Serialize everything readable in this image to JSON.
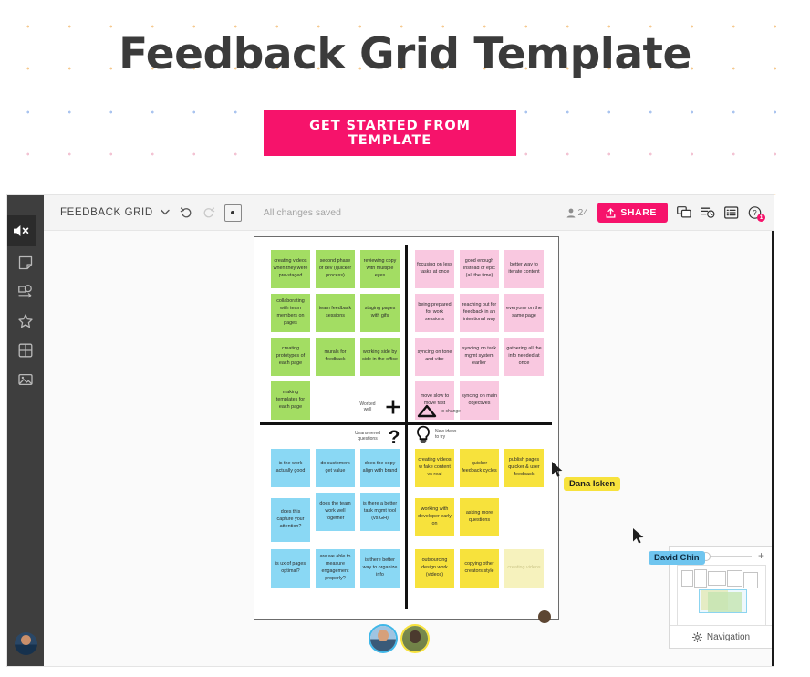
{
  "hero": {
    "title": "Feedback Grid Template",
    "cta_label": "GET STARTED FROM TEMPLATE",
    "accent_color": "#f6136b",
    "title_color": "#3b3b3b"
  },
  "topbar": {
    "board_name": "FEEDBACK GRID",
    "dropdown_icon": "chevron-down-icon",
    "undo_icon": "undo-icon",
    "redo_icon": "redo-icon",
    "pen_icon": "pen-color-icon",
    "save_status": "All changes saved",
    "users_icon": "user-icon",
    "users_count": "24",
    "share_label": "SHARE",
    "share_icon": "upload-icon",
    "comments_icon": "comments-icon",
    "activity_icon": "activity-history-icon",
    "outline_icon": "outline-list-icon",
    "help_icon": "help-question-icon",
    "help_badge": "1"
  },
  "rail": {
    "mute_icon": "speaker-muted-icon",
    "tools": [
      {
        "name": "collapse-panel-icon"
      },
      {
        "name": "sticky-note-icon"
      },
      {
        "name": "shape-connector-icon"
      },
      {
        "name": "star-icon"
      },
      {
        "name": "grid-table-icon"
      },
      {
        "name": "image-icon"
      }
    ],
    "avatar_name": "user-avatar"
  },
  "board": {
    "quadrants": [
      {
        "id": "worked-well",
        "label": "Worked\nwell",
        "icon": "plus-icon",
        "color": "#a3dd63",
        "notes": [
          "creating videos when they were pre-staged",
          "second phase of dev (quicker process)",
          "reviewing copy with multiple eyes",
          "collaborating with team members on pages",
          "team feedback sessions",
          "staging pages with gifs",
          "creating prototypes of each page",
          "murals for feedback",
          "working side by side in the office",
          "making templates for each page"
        ]
      },
      {
        "id": "to-change",
        "label": "to change",
        "icon": "delta-icon",
        "color": "#f9c8e0",
        "notes": [
          "focusing on less tasks at once",
          "good enough instead of epic (all the time)",
          "better way to iterate content",
          "being prepared for work sessions",
          "reaching out for feedback in an intentional way",
          "everyone on the same page",
          "syncing on tone and vibe",
          "syncing on task mgmt system earlier",
          "gathering all the info needed at once",
          "move slow to move fast",
          "syncing on main objectives"
        ]
      },
      {
        "id": "unanswered-questions",
        "label": "Unanswered\nquestions",
        "icon": "question-mark-icon",
        "color": "#8ad8f4",
        "notes": [
          "is the work actually good",
          "do customers get value",
          "does the copy align with brand",
          "does this capture your attention?",
          "does the team work well together",
          "is there a better task mgmt tool (vs GH)",
          "is ux of pages optimal?",
          "are we able to measure engagement properly?",
          "is there better way to organize info"
        ]
      },
      {
        "id": "new-ideas",
        "label": "New ideas\nto try",
        "icon": "lightbulb-icon",
        "color": "#f7e23c",
        "notes": [
          "creating videos w fake content vs real",
          "quicker feedback cycles",
          "publish pages quicker & user feedback",
          "working with developer early on",
          "asking more questions",
          "outsourcing design work (videos)",
          "copying other creators style",
          "creating videos"
        ]
      }
    ]
  },
  "cursors": [
    {
      "name": "Dana Isken",
      "color": "#f7e23c",
      "style": "yellow"
    },
    {
      "name": "David Chin",
      "color": "#6fc5ef",
      "style": "blue"
    }
  ],
  "navigation": {
    "zoom_out_label": "−",
    "zoom_in_label": "+",
    "footer_label": "Navigation",
    "footer_icon": "gear-icon"
  }
}
